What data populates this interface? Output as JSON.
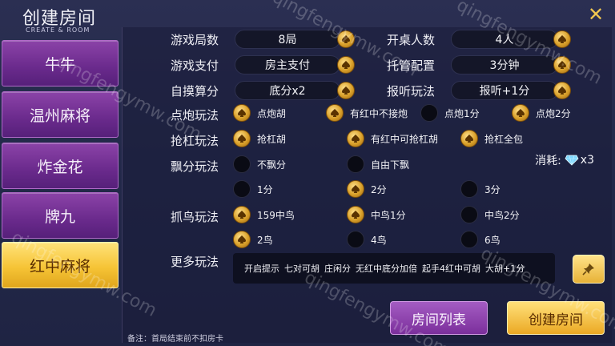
{
  "header": {
    "title": "创建房间",
    "subtitle": "CREATE & ROOM",
    "close_symbol": "✕"
  },
  "sidebar": {
    "items": [
      {
        "label": "牛牛",
        "active": false
      },
      {
        "label": "温州麻将",
        "active": false
      },
      {
        "label": "炸金花",
        "active": false
      },
      {
        "label": "牌九",
        "active": false
      },
      {
        "label": "红中麻将",
        "active": true
      }
    ]
  },
  "settings": {
    "rounds": {
      "label": "游戏局数",
      "value": "8局"
    },
    "players": {
      "label": "开桌人数",
      "value": "4人"
    },
    "payment": {
      "label": "游戏支付",
      "value": "房主支付"
    },
    "trustee": {
      "label": "托管配置",
      "value": "3分钟"
    },
    "zimo": {
      "label": "自摸算分",
      "value": "底分x2"
    },
    "baoting": {
      "label": "报听玩法",
      "value": "报听+1分"
    }
  },
  "dianpao": {
    "label": "点炮玩法",
    "options": [
      {
        "text": "点炮胡",
        "on": true
      },
      {
        "text": "有红中不接炮",
        "on": true
      },
      {
        "text": "点炮1分",
        "on": false
      },
      {
        "text": "点炮2分",
        "on": true
      }
    ]
  },
  "qianggang": {
    "label": "抢杠玩法",
    "options": [
      {
        "text": "抢杠胡",
        "on": true
      },
      {
        "text": "有红中可抢杠胡",
        "on": true
      },
      {
        "text": "抢杠全包",
        "on": true
      }
    ]
  },
  "piaofen": {
    "label": "飘分玩法",
    "options": [
      {
        "text": "不飘分",
        "on": false
      },
      {
        "text": "自由下飘",
        "on": false
      },
      {
        "text": "1分",
        "on": false
      },
      {
        "text": "2分",
        "on": true
      },
      {
        "text": "3分",
        "on": false
      }
    ]
  },
  "zhuaniao": {
    "label": "抓鸟玩法",
    "options": [
      {
        "text": "159中鸟",
        "on": true
      },
      {
        "text": "中鸟1分",
        "on": true
      },
      {
        "text": "中鸟2分",
        "on": false
      },
      {
        "text": "2鸟",
        "on": true
      },
      {
        "text": "4鸟",
        "on": false
      },
      {
        "text": "6鸟",
        "on": false
      }
    ]
  },
  "cost": {
    "label": "消耗:",
    "amount": "x3"
  },
  "more": {
    "label": "更多玩法",
    "items": [
      "开启提示",
      "七对可胡",
      "庄闲分",
      "无红中底分加倍",
      "起手4红中可胡",
      "大胡+1分"
    ]
  },
  "actions": {
    "room_list": "房间列表",
    "create_room": "创建房间"
  },
  "note": "备注：首局结束前不扣房卡",
  "watermark": "qingfengymw.com",
  "colors": {
    "gold": "#f0c650",
    "purple": "#7b2f9c",
    "panel": "#23294a"
  }
}
